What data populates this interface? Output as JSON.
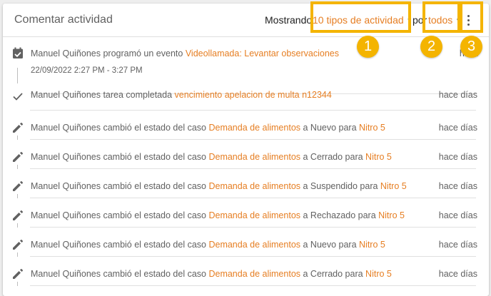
{
  "header": {
    "title": "Comentar actividad",
    "showing_label": "Mostrando",
    "type_filter": "10 tipos de actividad",
    "by_label": "por",
    "who_filter": "todos"
  },
  "callouts": [
    "1",
    "2",
    "3"
  ],
  "activities": [
    {
      "icon": "calendar-check-icon",
      "pre": "Manuel Quiñones programó un evento ",
      "link1": "Videollamada: Levantar observaciones",
      "mid": "",
      "link2": "",
      "time": "hace ",
      "date": "22/09/2022 2:27 PM - 3:27 PM"
    },
    {
      "icon": "check-icon",
      "pre": "Manuel Quiñones tarea completada ",
      "link1": "vencimiento apelacion de multa n12344",
      "mid": "",
      "link2": "",
      "time": "hace días"
    },
    {
      "icon": "pencil-icon",
      "pre": "Manuel Quiñones cambió el estado del caso ",
      "link1": "Demanda de alimentos",
      "mid": " a Nuevo para ",
      "link2": "Nitro 5",
      "time": "hace días"
    },
    {
      "icon": "pencil-icon",
      "pre": "Manuel Quiñones cambió el estado del caso ",
      "link1": "Demanda de alimentos",
      "mid": " a Cerrado para ",
      "link2": "Nitro 5",
      "time": "hace días"
    },
    {
      "icon": "pencil-icon",
      "pre": "Manuel Quiñones cambió el estado del caso ",
      "link1": "Demanda de alimentos",
      "mid": " a Suspendido para ",
      "link2": "Nitro 5",
      "time": "hace días"
    },
    {
      "icon": "pencil-icon",
      "pre": "Manuel Quiñones cambió el estado del caso ",
      "link1": "Demanda de alimentos",
      "mid": " a Rechazado para ",
      "link2": "Nitro 5",
      "time": "hace días"
    },
    {
      "icon": "pencil-icon",
      "pre": "Manuel Quiñones cambió el estado del caso ",
      "link1": "Demanda de alimentos",
      "mid": " a Nuevo para ",
      "link2": "Nitro 5",
      "time": "hace días"
    },
    {
      "icon": "pencil-icon",
      "pre": "Manuel Quiñones cambió el estado del caso ",
      "link1": "Demanda de alimentos",
      "mid": " a Cerrado para ",
      "link2": "Nitro 5",
      "time": "hace días"
    }
  ],
  "colors": {
    "accent": "#e67e22",
    "highlight": "#f4b400"
  }
}
